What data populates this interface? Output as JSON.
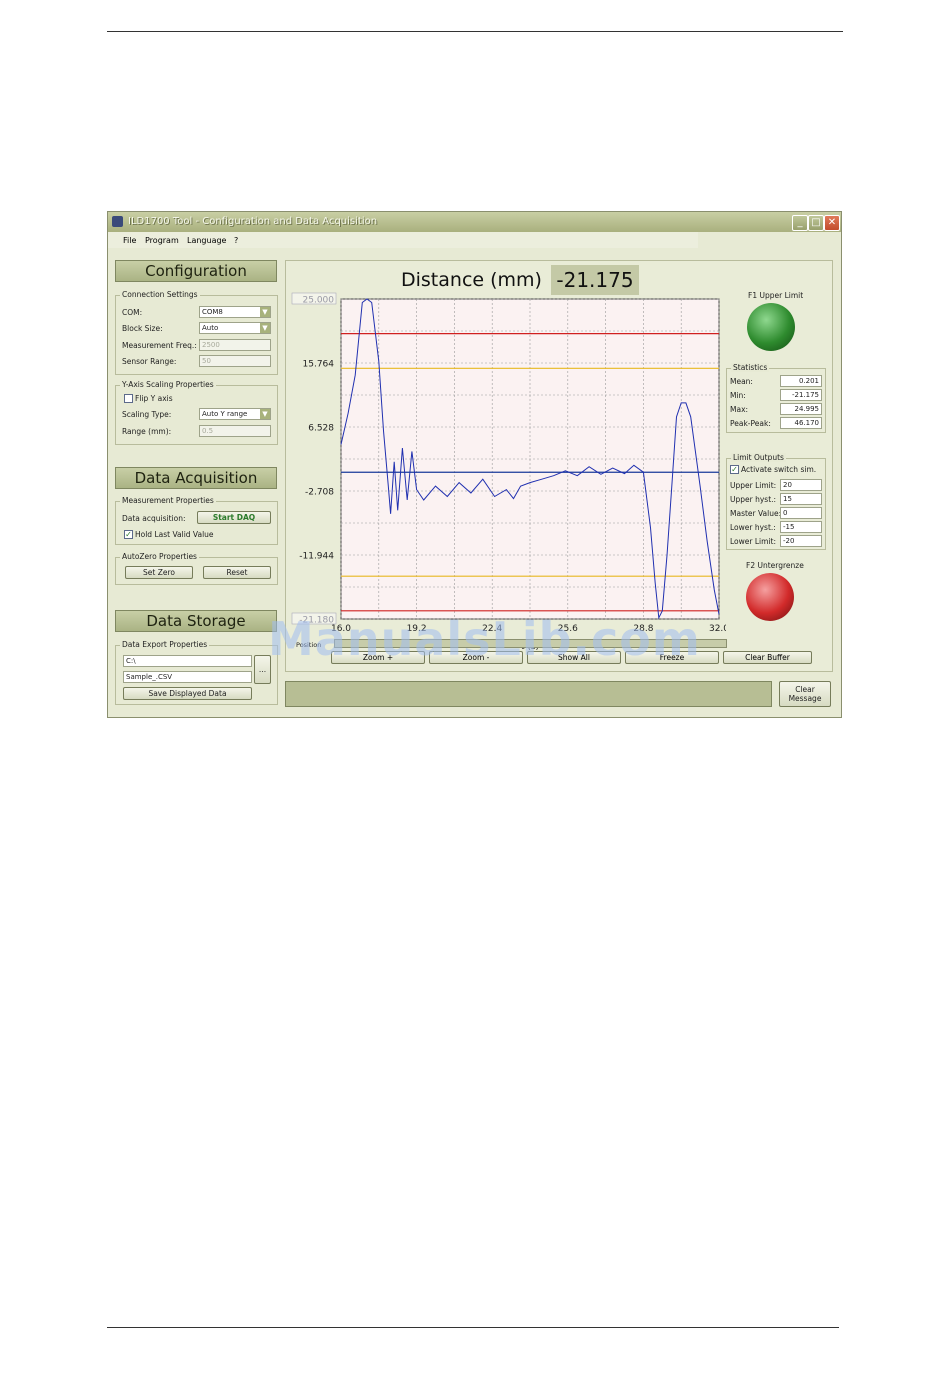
{
  "window": {
    "title": "ILD1700 Tool - Configuration and Data Acquisition",
    "min": "_",
    "max": "□",
    "close": "✕"
  },
  "menu": [
    "File",
    "Program",
    "Language",
    "?"
  ],
  "config": {
    "header": "Configuration",
    "connection_legend": "Connection Settings",
    "com_label": "COM:",
    "com_value": "COM8",
    "block_label": "Block Size:",
    "block_value": "Auto",
    "freq_label": "Measurement Freq.:",
    "freq_value": "2500",
    "range_label": "Sensor Range:",
    "range_value": "50",
    "yaxis_legend": "Y-Axis Scaling Properties",
    "flip_label": "Flip Y axis",
    "scaling_label": "Scaling Type:",
    "scaling_value": "Auto Y range",
    "rangemm_label": "Range (mm):",
    "rangemm_value": "0.5"
  },
  "daq": {
    "header": "Data Acquisition",
    "legend": "Measurement Properties",
    "acq_label": "Data acquisition:",
    "start_button": "Start DAQ",
    "hold_label": "Hold Last Valid Value",
    "autozero_legend": "AutoZero Properties",
    "set_zero": "Set Zero",
    "reset": "Reset"
  },
  "storage": {
    "header": "Data Storage",
    "legend": "Data Export Properties",
    "path": "C:\\",
    "file": "Sample_.CSV",
    "browse": "...",
    "save_button": "Save Displayed Data"
  },
  "display": {
    "title": "Distance (mm)",
    "value": "-21.175"
  },
  "leds": {
    "f1_label": "F1 Upper Limit",
    "f1_color": "#2e8b2e",
    "f2_label": "F2 Untergrenze",
    "f2_color": "#d22a2a"
  },
  "statistics": {
    "legend": "Statistics",
    "rows": [
      {
        "label": "Mean:",
        "value": "0.201"
      },
      {
        "label": "Min:",
        "value": "-21.175"
      },
      {
        "label": "Max:",
        "value": "24.995"
      },
      {
        "label": "Peak-Peak:",
        "value": "46.170"
      }
    ]
  },
  "limits": {
    "legend": "Limit Outputs",
    "activate_label": "Activate switch sim.",
    "rows": [
      {
        "label": "Upper Limit:",
        "value": "20"
      },
      {
        "label": "Upper hyst.:",
        "value": "15"
      },
      {
        "label": "Master Value:",
        "value": "0"
      },
      {
        "label": "Lower hyst.:",
        "value": "-15"
      },
      {
        "label": "Lower Limit:",
        "value": "-20"
      }
    ]
  },
  "chart_buttons": [
    "Zoom +",
    "Zoom -",
    "Show All",
    "Freeze",
    "Clear Buffer"
  ],
  "clear_message": "Clear Message",
  "scroll_label": "Position",
  "watermark": "ManualsLib.com",
  "chart_data": {
    "type": "line",
    "xlabel": "t (s)",
    "ylim": [
      -21.18,
      25.0
    ],
    "xlim": [
      16.0,
      32.0
    ],
    "x_ticks": [
      "16.0",
      "19.2",
      "22.4",
      "25.6",
      "28.8",
      "32.0"
    ],
    "y_ticks": [
      "25.000",
      "15.764",
      "6.528",
      "-2.708",
      "-11.944",
      "-21.180"
    ],
    "limit_lines": [
      {
        "name": "upper limit",
        "value": 20,
        "color": "#d02020"
      },
      {
        "name": "upper hyst",
        "value": 15,
        "color": "#e8b820"
      },
      {
        "name": "master",
        "value": 0,
        "color": "#1a3a9a"
      },
      {
        "name": "lower hyst",
        "value": -15,
        "color": "#e8b820"
      },
      {
        "name": "lower limit",
        "value": -20,
        "color": "#d02020"
      }
    ],
    "series": [
      {
        "color": "#2030b0",
        "x": [
          16.0,
          16.3,
          16.6,
          16.9,
          17.1,
          17.3,
          17.6,
          17.8,
          18.0,
          18.1,
          18.25,
          18.4,
          18.6,
          18.8,
          19.0,
          19.2,
          19.5,
          20.0,
          20.5,
          21.0,
          21.5,
          22.0,
          22.5,
          23.0,
          23.3,
          23.6,
          24.0,
          24.5,
          25.0,
          25.5,
          26.0,
          26.5,
          27.0,
          27.5,
          28.0,
          28.4,
          28.8,
          29.1,
          29.3,
          29.45,
          29.6,
          29.8,
          30.0,
          30.2,
          30.4,
          30.6,
          30.8,
          31.0,
          31.2,
          31.5,
          31.8,
          32.0
        ],
        "y": [
          4.0,
          8.5,
          14.0,
          24.5,
          25.0,
          24.5,
          16.0,
          6.0,
          -2.0,
          -6.0,
          1.5,
          -5.5,
          3.5,
          -4.0,
          3.0,
          -2.5,
          -4.0,
          -2.0,
          -3.5,
          -1.5,
          -3.0,
          -1.0,
          -3.5,
          -2.5,
          -3.8,
          -2.0,
          -1.5,
          -1.0,
          -0.5,
          0.2,
          -0.5,
          0.8,
          -0.3,
          0.6,
          -0.2,
          1.0,
          0.0,
          -8.0,
          -16.0,
          -21.0,
          -20.0,
          -12.0,
          -2.0,
          8.0,
          10.0,
          10.0,
          8.0,
          3.0,
          -2.0,
          -10.0,
          -17.0,
          -20.5
        ]
      }
    ]
  }
}
